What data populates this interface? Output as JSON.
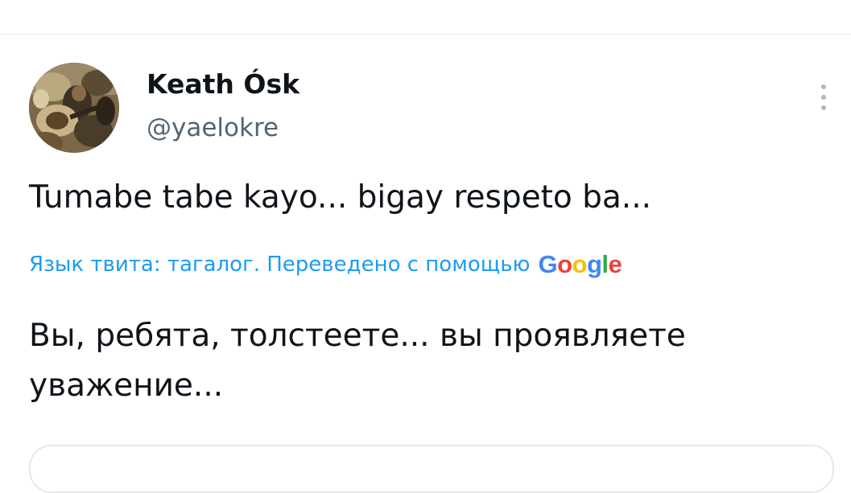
{
  "tweet": {
    "author": {
      "display_name": "Keath Ósk",
      "handle": "@yaelokre",
      "avatar_icon": "profile-photo"
    },
    "text": "Tumabe tabe kayo... bigay respeto ba...",
    "translation": {
      "label": "Язык твита: тагалог. Переведено с помощью",
      "provider": "Google",
      "text": "Вы, ребята, толстеете... вы проявляете\nуважение..."
    },
    "more_icon": "more-vertical-icon"
  },
  "colors": {
    "link": "#1d9bf0",
    "secondary_text": "#536471",
    "primary_text": "#0f1419",
    "divider": "#e6e8ea",
    "google_blue": "#4285F4",
    "google_red": "#EA4335",
    "google_yellow": "#FBBC05",
    "google_green": "#34A853"
  }
}
